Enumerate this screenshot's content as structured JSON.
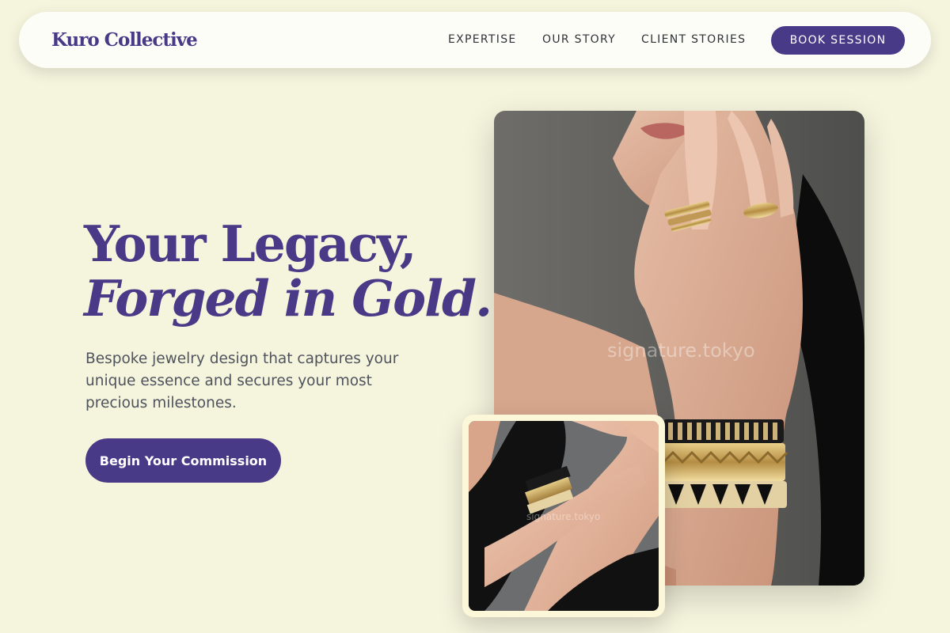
{
  "nav": {
    "logo": "Kuro Collective",
    "links": [
      "EXPERTISE",
      "OUR STORY",
      "CLIENT STORIES"
    ],
    "cta": "BOOK SESSION"
  },
  "hero": {
    "title_line1": "Your Legacy,",
    "title_line2": "Forged in Gold.",
    "subtitle": "Bespoke jewelry design that captures your unique essence and secures your most precious milestones.",
    "cta": "Begin Your Commission"
  },
  "images": {
    "main_watermark": "signature.tokyo",
    "small_watermark": "signature.tokyo"
  },
  "colors": {
    "background": "#f5f4dd",
    "accent": "#493a87",
    "text": "#4f535d"
  }
}
